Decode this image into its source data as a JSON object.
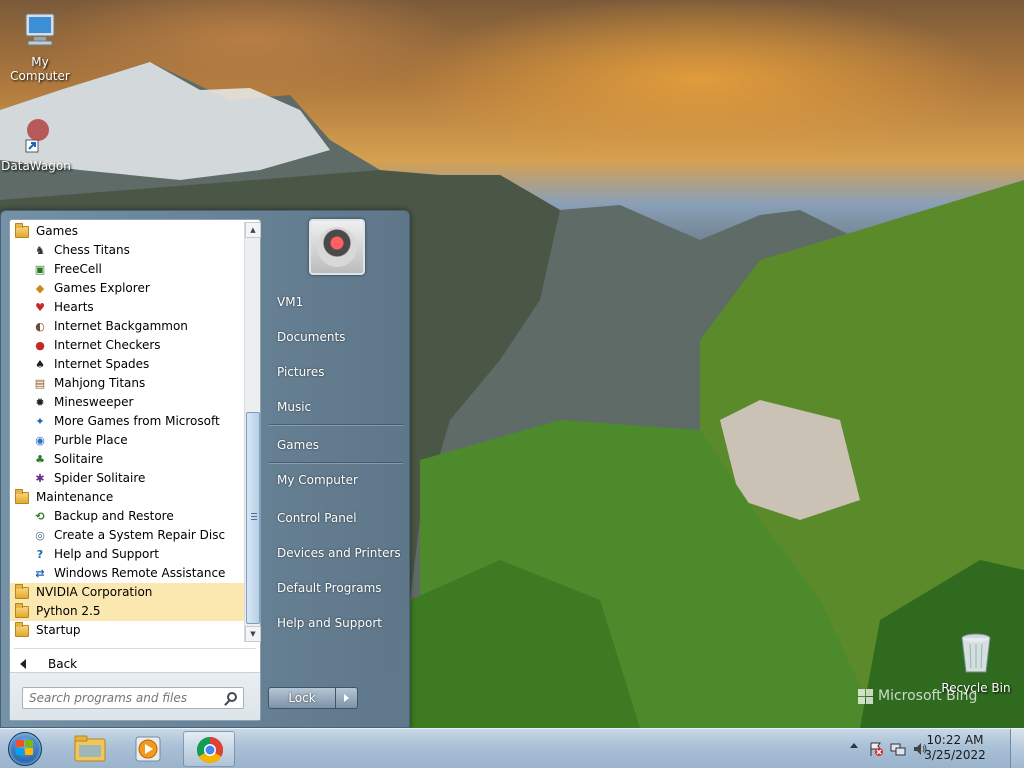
{
  "desktop": {
    "icons": [
      {
        "label": "My Computer",
        "icon": "computer-icon"
      },
      {
        "label": "DataWagon",
        "icon": "shortcut-icon"
      },
      {
        "label": "Recycle Bin",
        "icon": "recycle-bin-icon"
      }
    ],
    "watermark": "Microsoft Bing"
  },
  "start_menu": {
    "programs": [
      {
        "label": "Games",
        "type": "folder",
        "icon": "folder-icon"
      },
      {
        "label": "Chess Titans",
        "type": "child",
        "icon": "chess-icon"
      },
      {
        "label": "FreeCell",
        "type": "child",
        "icon": "freecell-icon"
      },
      {
        "label": "Games Explorer",
        "type": "child",
        "icon": "games-explorer-icon"
      },
      {
        "label": "Hearts",
        "type": "child",
        "icon": "hearts-icon"
      },
      {
        "label": "Internet Backgammon",
        "type": "child",
        "icon": "backgammon-icon"
      },
      {
        "label": "Internet Checkers",
        "type": "child",
        "icon": "checkers-icon"
      },
      {
        "label": "Internet Spades",
        "type": "child",
        "icon": "spades-icon"
      },
      {
        "label": "Mahjong Titans",
        "type": "child",
        "icon": "mahjong-icon"
      },
      {
        "label": "Minesweeper",
        "type": "child",
        "icon": "minesweeper-icon"
      },
      {
        "label": "More Games from Microsoft",
        "type": "child",
        "icon": "more-games-icon"
      },
      {
        "label": "Purble Place",
        "type": "child",
        "icon": "purble-place-icon"
      },
      {
        "label": "Solitaire",
        "type": "child",
        "icon": "solitaire-icon"
      },
      {
        "label": "Spider Solitaire",
        "type": "child",
        "icon": "spider-solitaire-icon"
      },
      {
        "label": "Maintenance",
        "type": "folder",
        "icon": "folder-icon"
      },
      {
        "label": "Backup and Restore",
        "type": "child",
        "icon": "backup-icon"
      },
      {
        "label": "Create a System Repair Disc",
        "type": "child",
        "icon": "repair-disc-icon"
      },
      {
        "label": "Help and Support",
        "type": "child",
        "icon": "help-icon"
      },
      {
        "label": "Windows Remote Assistance",
        "type": "child",
        "icon": "remote-assistance-icon"
      },
      {
        "label": "NVIDIA Corporation",
        "type": "folder",
        "icon": "folder-icon",
        "highlight": true
      },
      {
        "label": "Python 2.5",
        "type": "folder",
        "icon": "folder-icon",
        "highlight": true
      },
      {
        "label": "Startup",
        "type": "folder",
        "icon": "folder-icon"
      }
    ],
    "back_label": "Back",
    "search_placeholder": "Search programs and files",
    "right_items": [
      {
        "label": "VM1"
      },
      {
        "label": "Documents"
      },
      {
        "label": "Pictures"
      },
      {
        "label": "Music"
      },
      {
        "label": "Games"
      },
      {
        "label": "My Computer"
      },
      {
        "label": "Control Panel"
      },
      {
        "label": "Devices and Printers"
      },
      {
        "label": "Default Programs"
      },
      {
        "label": "Help and Support"
      }
    ],
    "lock_label": "Lock"
  },
  "taskbar": {
    "time": "10:22 AM",
    "date": "3/25/2022"
  }
}
